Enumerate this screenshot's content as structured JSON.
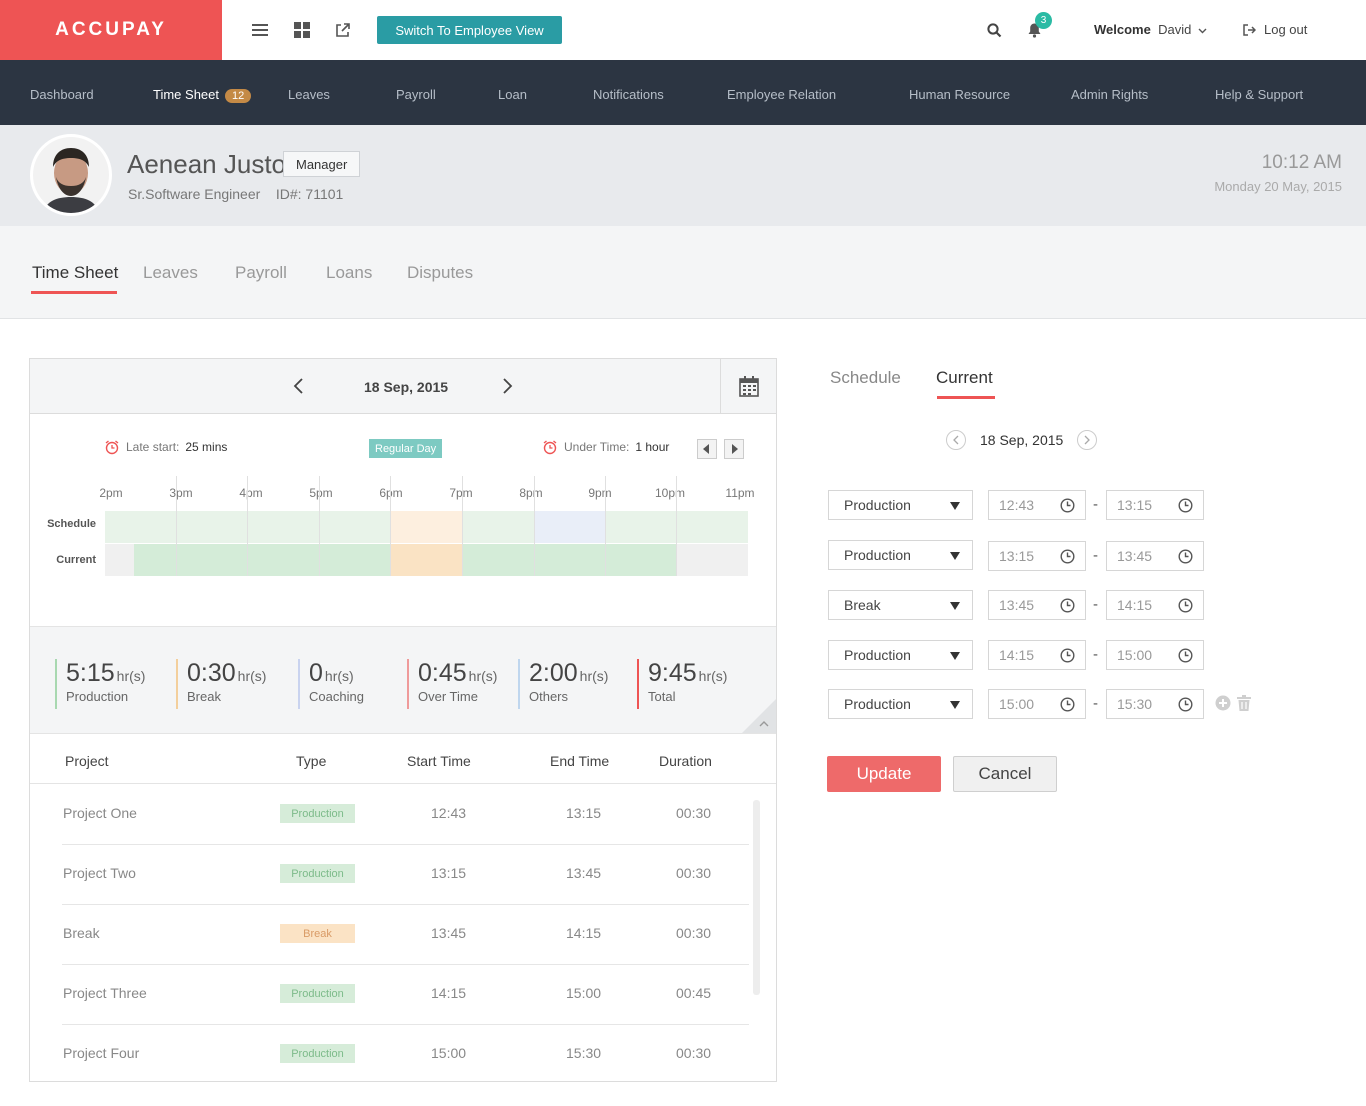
{
  "app": {
    "logo": "ACCUPAY",
    "switch_label": "Switch To Employee View",
    "notification_count": "3",
    "welcome_label": "Welcome",
    "user_name": "David",
    "logout_label": "Log out"
  },
  "nav": {
    "items": [
      {
        "label": "Dashboard"
      },
      {
        "label": "Time Sheet",
        "badge": "12"
      },
      {
        "label": "Leaves"
      },
      {
        "label": "Payroll"
      },
      {
        "label": "Loan"
      },
      {
        "label": "Notifications"
      },
      {
        "label": "Employee Relation"
      },
      {
        "label": "Human Resource"
      },
      {
        "label": "Admin Rights"
      },
      {
        "label": "Help & Support"
      }
    ]
  },
  "profile": {
    "name": "Aenean Justo",
    "role": "Manager",
    "title": "Sr.Software Engineer",
    "id_label": "ID#: 71101",
    "time": "10:12 AM",
    "date": "Monday 20 May, 2015"
  },
  "subtabs": [
    "Time Sheet",
    "Leaves",
    "Payroll",
    "Loans",
    "Disputes"
  ],
  "timesheet": {
    "date": "18 Sep, 2015",
    "late_start_label": "Late start:",
    "late_start_value": "25 mins",
    "day_type": "Regular Day",
    "under_time_label": "Under Time:",
    "under_time_value": "1 hour",
    "hours": [
      "2pm",
      "3pm",
      "4pm",
      "5pm",
      "6pm",
      "7pm",
      "8pm",
      "9pm",
      "10pm",
      "11pm"
    ],
    "row_labels": {
      "schedule": "Schedule",
      "current": "Current"
    }
  },
  "summary": [
    {
      "value": "5:15",
      "unit": "hr(s)",
      "label": "Production",
      "color": "#a8d8b0"
    },
    {
      "value": "0:30",
      "unit": "hr(s)",
      "label": "Break",
      "color": "#f3cf9c"
    },
    {
      "value": "0",
      "unit": "hr(s)",
      "label": "Coaching",
      "color": "#c9d3ef"
    },
    {
      "value": "0:45",
      "unit": "hr(s)",
      "label": "Over Time",
      "color": "#ef9a9a"
    },
    {
      "value": "2:00",
      "unit": "hr(s)",
      "label": "Others",
      "color": "#bfd6ee"
    },
    {
      "value": "9:45",
      "unit": "hr(s)",
      "label": "Total",
      "color": "#ee5454"
    }
  ],
  "table": {
    "headers": [
      "Project",
      "Type",
      "Start Time",
      "End Time",
      "Duration"
    ],
    "rows": [
      {
        "project": "Project One",
        "type": "Production",
        "start": "12:43",
        "end": "13:15",
        "duration": "00:30"
      },
      {
        "project": "Project Two",
        "type": "Production",
        "start": "13:15",
        "end": "13:45",
        "duration": "00:30"
      },
      {
        "project": "Break",
        "type": "Break",
        "start": "13:45",
        "end": "14:15",
        "duration": "00:30"
      },
      {
        "project": "Project Three",
        "type": "Production",
        "start": "14:15",
        "end": "15:00",
        "duration": "00:45"
      },
      {
        "project": "Project Four",
        "type": "Production",
        "start": "15:00",
        "end": "15:30",
        "duration": "00:30"
      }
    ]
  },
  "editor": {
    "tabs": [
      "Schedule",
      "Current"
    ],
    "date": "18 Sep, 2015",
    "entries": [
      {
        "type": "Production",
        "start": "12:43",
        "end": "13:15"
      },
      {
        "type": "Production",
        "start": "13:15",
        "end": "13:45"
      },
      {
        "type": "Break",
        "start": "13:45",
        "end": "14:15"
      },
      {
        "type": "Production",
        "start": "14:15",
        "end": "15:00"
      },
      {
        "type": "Production",
        "start": "15:00",
        "end": "15:30"
      }
    ],
    "separator": "-",
    "update_label": "Update",
    "cancel_label": "Cancel"
  }
}
